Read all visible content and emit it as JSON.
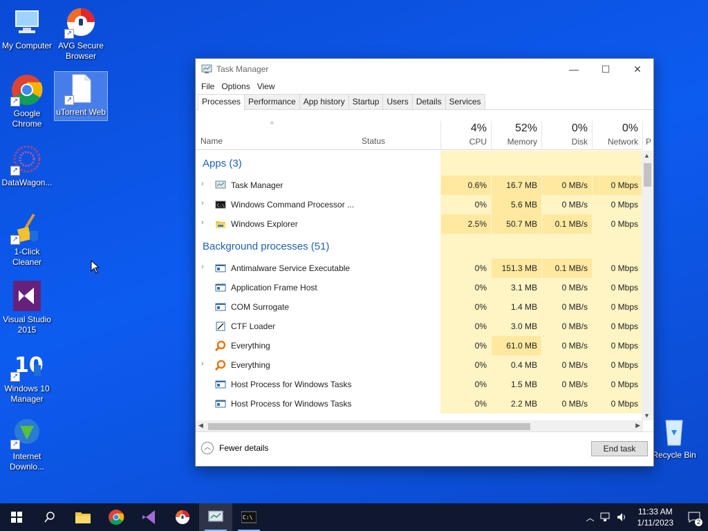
{
  "desktop": {
    "icons": [
      {
        "label": "My Computer"
      },
      {
        "label": "AVG Secure Browser"
      },
      {
        "label": "Google Chrome"
      },
      {
        "label": "uTorrent Web"
      },
      {
        "label": "DataWagon..."
      },
      {
        "label": "1-Click Cleaner"
      },
      {
        "label": "Visual Studio 2015"
      },
      {
        "label": "Windows 10 Manager"
      },
      {
        "label": "Internet Downlo..."
      },
      {
        "label": "Recycle Bin"
      }
    ]
  },
  "window": {
    "title": "Task Manager",
    "menu": [
      "File",
      "Options",
      "View"
    ],
    "tabs": [
      "Processes",
      "Performance",
      "App history",
      "Startup",
      "Users",
      "Details",
      "Services"
    ],
    "active_tab": "Processes",
    "columns": {
      "name": "Name",
      "status": "Status",
      "cpu": {
        "pct": "4%",
        "label": "CPU"
      },
      "memory": {
        "pct": "52%",
        "label": "Memory"
      },
      "disk": {
        "pct": "0%",
        "label": "Disk"
      },
      "network": {
        "pct": "0%",
        "label": "Network"
      },
      "power_partial": "P"
    },
    "groups": [
      {
        "title": "Apps (3)",
        "rows": [
          {
            "name": "Task Manager",
            "expandable": true,
            "icon": "task-manager-icon",
            "cpu": "0.6%",
            "memory": "16.7 MB",
            "disk": "0 MB/s",
            "network": "0 Mbps"
          },
          {
            "name": "Windows Command Processor ...",
            "expandable": true,
            "icon": "cmd-icon",
            "cpu": "0%",
            "memory": "5.6 MB",
            "disk": "0 MB/s",
            "network": "0 Mbps"
          },
          {
            "name": "Windows Explorer",
            "expandable": true,
            "icon": "folder-icon",
            "cpu": "2.5%",
            "memory": "50.7 MB",
            "disk": "0.1 MB/s",
            "network": "0 Mbps"
          }
        ]
      },
      {
        "title": "Background processes (51)",
        "rows": [
          {
            "name": "Antimalware Service Executable",
            "expandable": true,
            "icon": "service-icon",
            "cpu": "0%",
            "memory": "151.3 MB",
            "disk": "0.1 MB/s",
            "network": "0 Mbps"
          },
          {
            "name": "Application Frame Host",
            "expandable": false,
            "icon": "service-icon",
            "cpu": "0%",
            "memory": "3.1 MB",
            "disk": "0 MB/s",
            "network": "0 Mbps"
          },
          {
            "name": "COM Surrogate",
            "expandable": false,
            "icon": "service-icon",
            "cpu": "0%",
            "memory": "1.4 MB",
            "disk": "0 MB/s",
            "network": "0 Mbps"
          },
          {
            "name": "CTF Loader",
            "expandable": false,
            "icon": "ctf-icon",
            "cpu": "0%",
            "memory": "3.0 MB",
            "disk": "0 MB/s",
            "network": "0 Mbps"
          },
          {
            "name": "Everything",
            "expandable": false,
            "icon": "search-icon",
            "cpu": "0%",
            "memory": "61.0 MB",
            "disk": "0 MB/s",
            "network": "0 Mbps"
          },
          {
            "name": "Everything",
            "expandable": true,
            "icon": "search-icon",
            "cpu": "0%",
            "memory": "0.4 MB",
            "disk": "0 MB/s",
            "network": "0 Mbps"
          },
          {
            "name": "Host Process for Windows Tasks",
            "expandable": false,
            "icon": "service-icon",
            "cpu": "0%",
            "memory": "1.5 MB",
            "disk": "0 MB/s",
            "network": "0 Mbps"
          },
          {
            "name": "Host Process for Windows Tasks",
            "expandable": false,
            "icon": "service-icon",
            "cpu": "0%",
            "memory": "2.2 MB",
            "disk": "0 MB/s",
            "network": "0 Mbps"
          }
        ]
      }
    ],
    "footer": {
      "fewer_details": "Fewer details",
      "end_task": "End task"
    }
  },
  "taskbar": {
    "time": "11:33 AM",
    "date": "1/11/2023",
    "notification_count": "2"
  },
  "colors": {
    "accent": "#1f5fb0",
    "heat_light": "#fff4c4",
    "heat_medium": "#ffe9a0",
    "desktop": "#0d5cf0"
  }
}
